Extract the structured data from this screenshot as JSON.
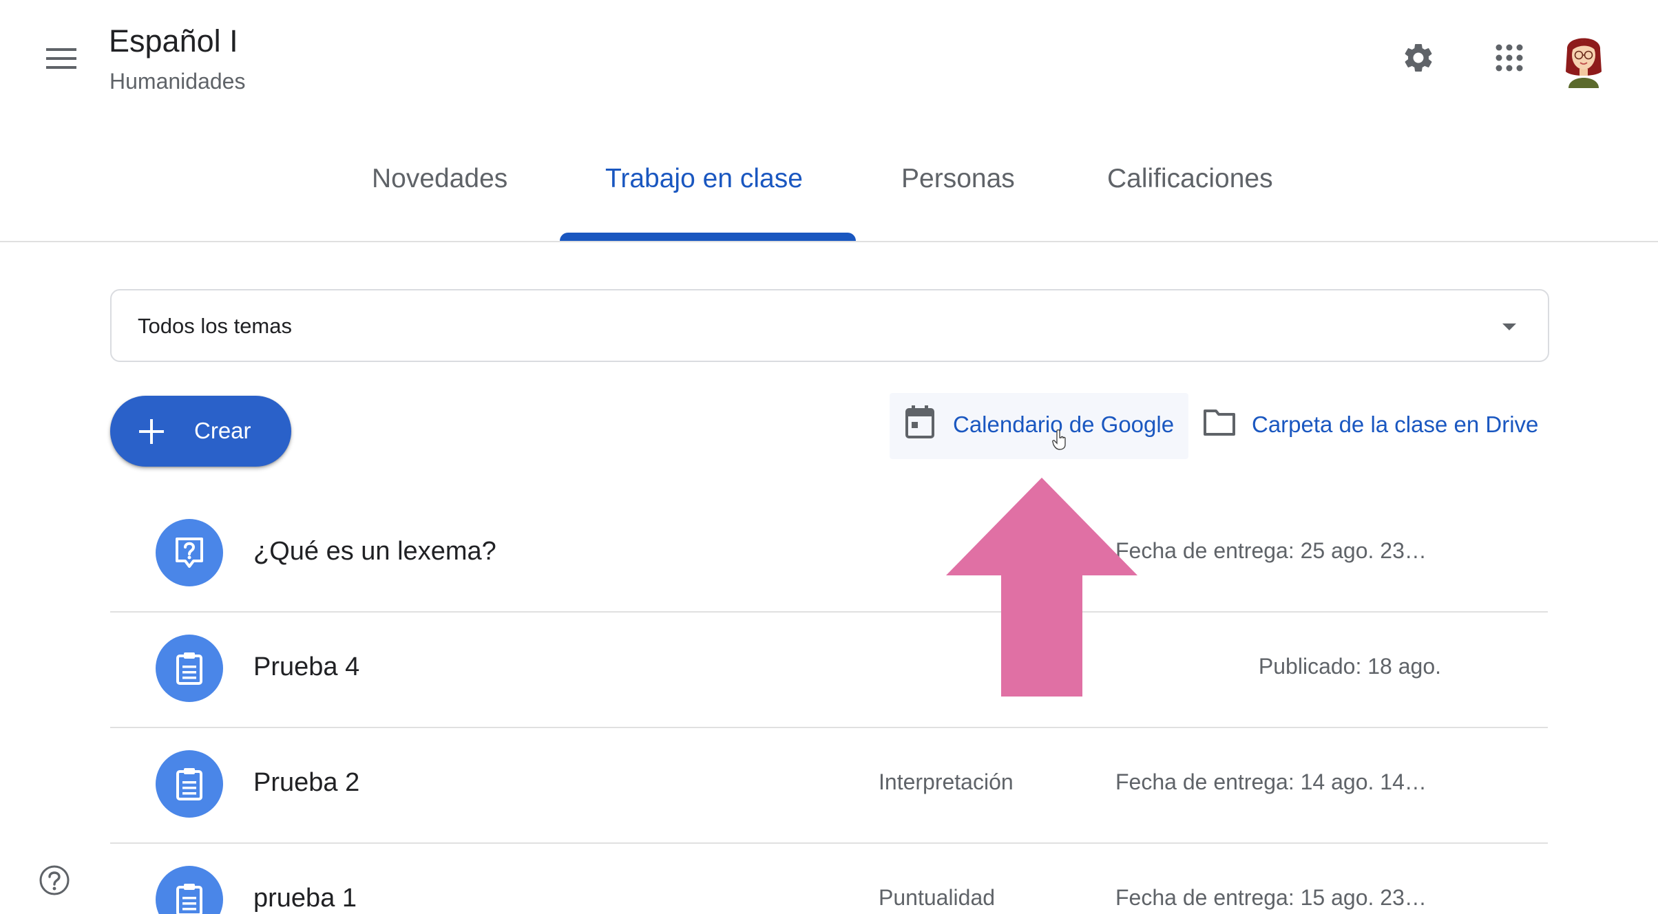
{
  "header": {
    "title": "Español I",
    "subtitle": "Humanidades",
    "menu_icon": "hamburger-menu-icon",
    "settings_icon": "gear-icon",
    "apps_icon": "apps-grid-icon",
    "avatar_icon": "user-avatar"
  },
  "tabs": [
    {
      "label": "Novedades",
      "active": false
    },
    {
      "label": "Trabajo en clase",
      "active": true
    },
    {
      "label": "Personas",
      "active": false
    },
    {
      "label": "Calificaciones",
      "active": false
    }
  ],
  "topic_filter": {
    "selected": "Todos los temas"
  },
  "create_button": {
    "label": "Crear"
  },
  "links": {
    "calendar": "Calendario de Google",
    "drive": "Carpeta de la clase en Drive"
  },
  "work_items": [
    {
      "title": "¿Qué es un lexema?",
      "type": "question",
      "topic": "",
      "status": "Fecha de entrega: 25 ago. 23…"
    },
    {
      "title": "Prueba 4",
      "type": "assignment",
      "topic": "",
      "status": "Publicado: 18 ago."
    },
    {
      "title": "Prueba 2",
      "type": "assignment",
      "topic": "Interpretación",
      "status": "Fecha de entrega: 14 ago. 14…"
    },
    {
      "title": "prueba 1",
      "type": "assignment",
      "topic": "Puntualidad",
      "status": "Fecha de entrega: 15 ago. 23…"
    }
  ],
  "colors": {
    "accent": "#1a57c0",
    "create_button": "#2a61c9",
    "item_icon": "#4a86e8",
    "overlay_arrow": "#e070a4"
  }
}
